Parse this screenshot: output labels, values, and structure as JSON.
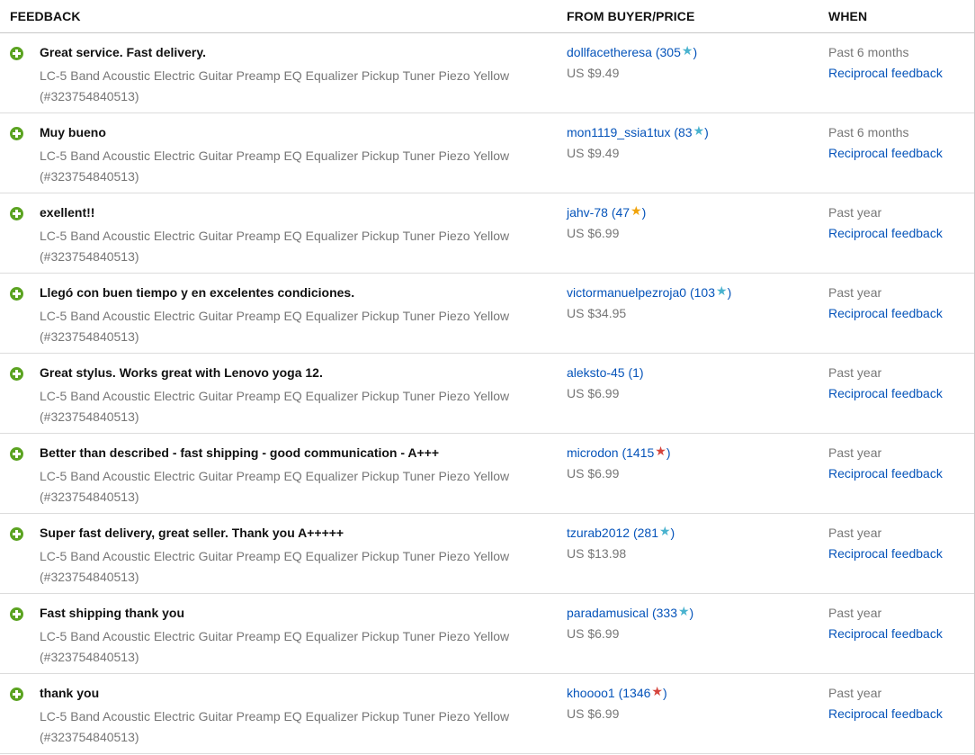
{
  "header": {
    "feedback": "FEEDBACK",
    "from": "FROM BUYER/PRICE",
    "when": "WHEN"
  },
  "colors": {
    "positive_icon": "#5ba321",
    "link": "#0654ba",
    "muted": "#767676",
    "star_turquoise": "#4ab3cf",
    "star_yellow": "#f0a30a",
    "star_red": "#d5443c"
  },
  "rows": [
    {
      "comment": "Great service. Fast delivery.",
      "item": "LC-5 Band Acoustic Electric Guitar Preamp EQ Equalizer Pickup Tuner Piezo Yellow (#323754840513)",
      "buyer": "dollfacetheresa",
      "score_open": "(305",
      "score_close": ")",
      "star": "★",
      "star_color": "#4ab3cf",
      "price": "US $9.49",
      "when": "Past 6 months",
      "reciprocal": "Reciprocal feedback"
    },
    {
      "comment": "Muy bueno",
      "item": "LC-5 Band Acoustic Electric Guitar Preamp EQ Equalizer Pickup Tuner Piezo Yellow (#323754840513)",
      "buyer": "mon1119_ssia1tux",
      "score_open": "(83",
      "score_close": ")",
      "star": "★",
      "star_color": "#4ab3cf",
      "price": "US $9.49",
      "when": "Past 6 months",
      "reciprocal": "Reciprocal feedback"
    },
    {
      "comment": "exellent!!",
      "item": "LC-5 Band Acoustic Electric Guitar Preamp EQ Equalizer Pickup Tuner Piezo Yellow (#323754840513)",
      "buyer": "jahv-78",
      "score_open": "(47",
      "score_close": ")",
      "star": "★",
      "star_color": "#f0a30a",
      "price": "US $6.99",
      "when": "Past year",
      "reciprocal": "Reciprocal feedback"
    },
    {
      "comment": "Llegó con buen tiempo y en excelentes condiciones.",
      "item": "LC-5 Band Acoustic Electric Guitar Preamp EQ Equalizer Pickup Tuner Piezo Yellow (#323754840513)",
      "buyer": "victormanuelpezroja0",
      "score_open": "(103",
      "score_close": ")",
      "star": "★",
      "star_color": "#4ab3cf",
      "price": "US $34.95",
      "when": "Past year",
      "reciprocal": "Reciprocal feedback"
    },
    {
      "comment": "Great stylus. Works great with Lenovo yoga 12.",
      "item": "LC-5 Band Acoustic Electric Guitar Preamp EQ Equalizer Pickup Tuner Piezo Yellow (#323754840513)",
      "buyer": "aleksto-45",
      "score_open": "(1)",
      "score_close": "",
      "star": "",
      "star_color": "",
      "price": "US $6.99",
      "when": "Past year",
      "reciprocal": "Reciprocal feedback"
    },
    {
      "comment": "Better than described - fast shipping - good communication - A+++",
      "item": "LC-5 Band Acoustic Electric Guitar Preamp EQ Equalizer Pickup Tuner Piezo Yellow (#323754840513)",
      "buyer": "microdon",
      "score_open": "(1415",
      "score_close": ")",
      "star": "★",
      "star_color": "#d5443c",
      "price": "US $6.99",
      "when": "Past year",
      "reciprocal": "Reciprocal feedback"
    },
    {
      "comment": "Super fast delivery, great seller. Thank you A+++++",
      "item": "LC-5 Band Acoustic Electric Guitar Preamp EQ Equalizer Pickup Tuner Piezo Yellow (#323754840513)",
      "buyer": "tzurab2012",
      "score_open": "(281",
      "score_close": ")",
      "star": "★",
      "star_color": "#4ab3cf",
      "price": "US $13.98",
      "when": "Past year",
      "reciprocal": "Reciprocal feedback"
    },
    {
      "comment": "Fast shipping thank you",
      "item": "LC-5 Band Acoustic Electric Guitar Preamp EQ Equalizer Pickup Tuner Piezo Yellow (#323754840513)",
      "buyer": "paradamusical",
      "score_open": "(333",
      "score_close": ")",
      "star": "★",
      "star_color": "#4ab3cf",
      "price": "US $6.99",
      "when": "Past year",
      "reciprocal": "Reciprocal feedback"
    },
    {
      "comment": "thank you",
      "item": "LC-5 Band Acoustic Electric Guitar Preamp EQ Equalizer Pickup Tuner Piezo Yellow (#323754840513)",
      "buyer": "khoooo1",
      "score_open": "(1346",
      "score_close": ")",
      "star": "★",
      "star_color": "#d5443c",
      "price": "US $6.99",
      "when": "Past year",
      "reciprocal": "Reciprocal feedback"
    }
  ]
}
